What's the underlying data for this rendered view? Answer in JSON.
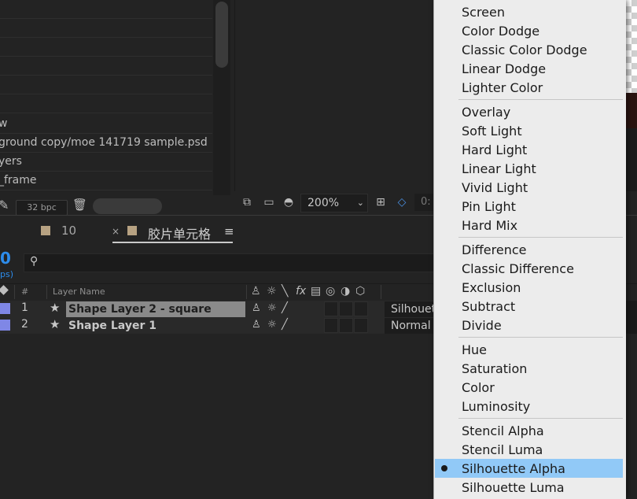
{
  "project": {
    "items": [
      "w",
      "ground copy/moe 141719 sample.psd",
      "yers",
      "_frame",
      "...."
    ],
    "bpc": "32 bpc"
  },
  "viewer": {
    "zoom": "200%",
    "zoom_caret": "⌄",
    "res_partial": "0:"
  },
  "tabs": [
    {
      "label": "10",
      "swatch_color": "#b7a282"
    },
    {
      "label": "胶片单元格",
      "close": "×",
      "menu": "≡",
      "swatch_color": "#b7a282"
    }
  ],
  "timeline": {
    "timecode": "0",
    "fps": "ps)",
    "search_placeholder": "",
    "headers": {
      "num": "#",
      "layer_name": "Layer Name",
      "fx": "fx"
    },
    "layers": [
      {
        "num": "1",
        "name": "Shape Layer 2 - square",
        "mode": "Silhouette Alpha",
        "label_color": "#7f87e6",
        "selected": true
      },
      {
        "num": "2",
        "name": "Shape Layer 1",
        "mode": "Normal",
        "label_color": "#7f87e6",
        "selected": false
      }
    ]
  },
  "blend_menu": {
    "selected": "Silhouette Alpha",
    "groups": [
      [
        "Screen",
        "Color Dodge",
        "Classic Color Dodge",
        "Linear Dodge",
        "Lighter Color"
      ],
      [
        "Overlay",
        "Soft Light",
        "Hard Light",
        "Linear Light",
        "Vivid Light",
        "Pin Light",
        "Hard Mix"
      ],
      [
        "Difference",
        "Classic Difference",
        "Exclusion",
        "Subtract",
        "Divide"
      ],
      [
        "Hue",
        "Saturation",
        "Color",
        "Luminosity"
      ],
      [
        "Stencil Alpha",
        "Stencil Luma",
        "Silhouette Alpha",
        "Silhouette Luma"
      ]
    ]
  },
  "colors": {
    "accent": "#2d8ceb",
    "menu_highlight": "#91c9f7",
    "layer_label": "#7f87e6"
  }
}
